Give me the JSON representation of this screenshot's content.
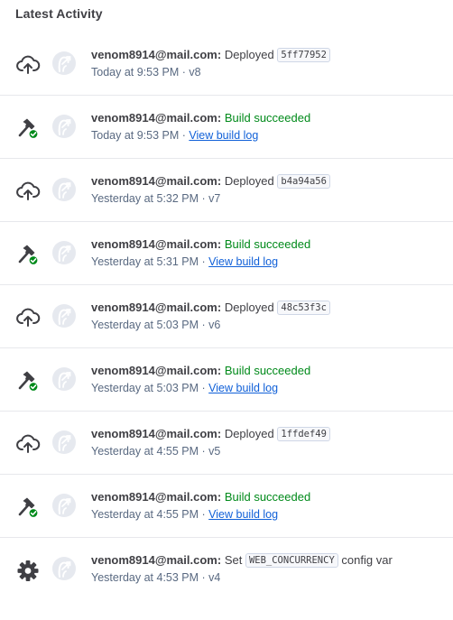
{
  "title": "Latest Activity",
  "activities": [
    {
      "type": "deploy",
      "type_icon": "cloud-upload-icon",
      "user": "venom8914@mail.com:",
      "action": "Deployed",
      "commit": "5ff77952",
      "time": "Today at 9:53 PM",
      "separator": " · ",
      "version": "v8"
    },
    {
      "type": "build",
      "type_icon": "hammer-check-icon",
      "user": "venom8914@mail.com:",
      "action": "Build succeeded",
      "time": "Today at 9:53 PM",
      "separator": " · ",
      "link": "View build log"
    },
    {
      "type": "deploy",
      "type_icon": "cloud-upload-icon",
      "user": "venom8914@mail.com:",
      "action": "Deployed",
      "commit": "b4a94a56",
      "time": "Yesterday at 5:32 PM",
      "separator": " · ",
      "version": "v7"
    },
    {
      "type": "build",
      "type_icon": "hammer-check-icon",
      "user": "venom8914@mail.com:",
      "action": "Build succeeded",
      "time": "Yesterday at 5:31 PM",
      "separator": " · ",
      "link": "View build log"
    },
    {
      "type": "deploy",
      "type_icon": "cloud-upload-icon",
      "user": "venom8914@mail.com:",
      "action": "Deployed",
      "commit": "48c53f3c",
      "time": "Yesterday at 5:03 PM",
      "separator": " · ",
      "version": "v6"
    },
    {
      "type": "build",
      "type_icon": "hammer-check-icon",
      "user": "venom8914@mail.com:",
      "action": "Build succeeded",
      "time": "Yesterday at 5:03 PM",
      "separator": " · ",
      "link": "View build log"
    },
    {
      "type": "deploy",
      "type_icon": "cloud-upload-icon",
      "user": "venom8914@mail.com:",
      "action": "Deployed",
      "commit": "1ffdef49",
      "time": "Yesterday at 4:55 PM",
      "separator": " · ",
      "version": "v5"
    },
    {
      "type": "build",
      "type_icon": "hammer-check-icon",
      "user": "venom8914@mail.com:",
      "action": "Build succeeded",
      "time": "Yesterday at 4:55 PM",
      "separator": " · ",
      "link": "View build log"
    },
    {
      "type": "config",
      "type_icon": "gear-icon",
      "user": "venom8914@mail.com:",
      "action": "Set",
      "config_var": "WEB_CONCURRENCY",
      "action_suffix": "config var",
      "time": "Yesterday at 4:53 PM",
      "separator": " · ",
      "version": "v4"
    }
  ],
  "colors": {
    "text": "#3f3f44",
    "muted": "#596981",
    "success": "#008a1a",
    "link": "#1060d8",
    "divider": "#e7e8ec"
  }
}
